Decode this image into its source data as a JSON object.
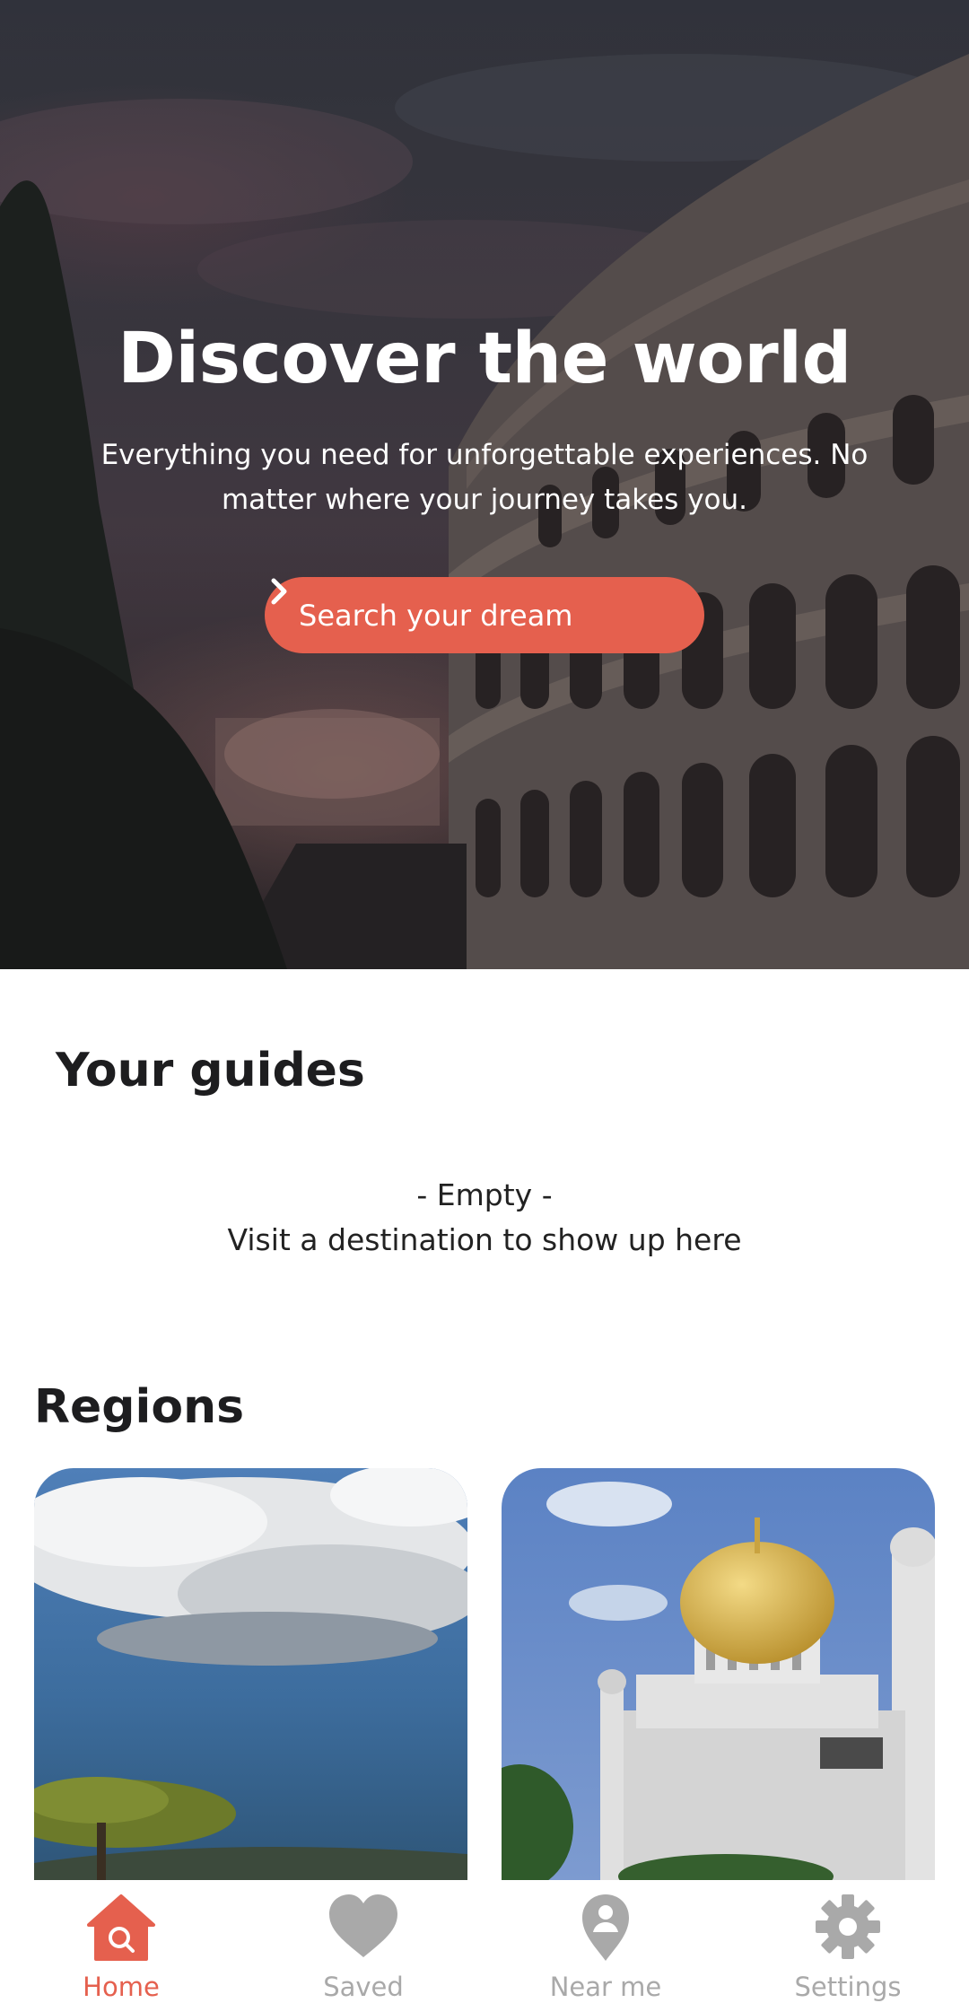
{
  "hero": {
    "title": "Discover the world",
    "subtitle": "Everything you need for unforgettable experiences. No matter where your journey takes you.",
    "cta_label": "Search your dream"
  },
  "guides": {
    "title": "Your guides",
    "empty_line1": "- Empty -",
    "empty_line2": "Visit a destination to show up here"
  },
  "regions": {
    "title": "Regions",
    "cards": [
      {
        "image": "savanna-landscape"
      },
      {
        "image": "golden-dome-mosque"
      }
    ]
  },
  "bottom_nav": {
    "items": [
      {
        "label": "Home",
        "icon": "home-search-icon",
        "active": true
      },
      {
        "label": "Saved",
        "icon": "heart-icon",
        "active": false
      },
      {
        "label": "Near me",
        "icon": "location-pin-icon",
        "active": false
      },
      {
        "label": "Settings",
        "icon": "gear-icon",
        "active": false
      }
    ]
  },
  "colors": {
    "accent": "#e5604e",
    "inactive": "#a9a9a9"
  }
}
